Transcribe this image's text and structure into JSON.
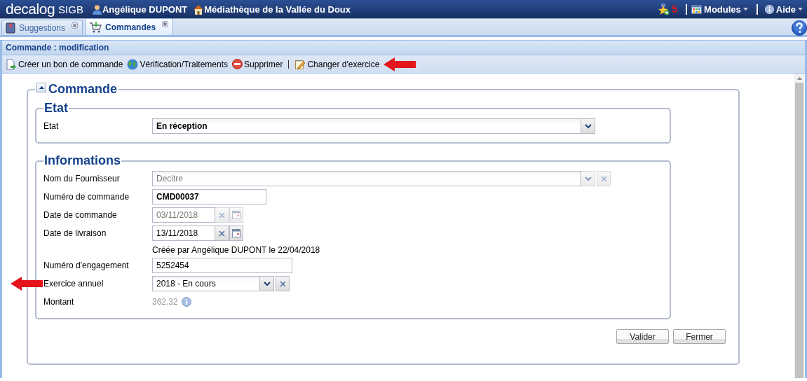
{
  "header": {
    "logo": "decalog",
    "logo_suffix": "SIGB",
    "user": "Angélique DUPONT",
    "library": "Médiathèque de la Vallée du Doux",
    "notifications": "5",
    "modules": "Modules",
    "help": "Aide"
  },
  "tabs": [
    {
      "label": "Suggestions",
      "selected": false,
      "kind": "book"
    },
    {
      "label": "Commandes",
      "selected": true,
      "kind": "cart"
    }
  ],
  "panel": {
    "title": "Commande : modification"
  },
  "toolbar": [
    {
      "kind": "new-doc",
      "label": "Créer un bon de commande",
      "pointed": false
    },
    {
      "kind": "globe",
      "label": "Vérification/Traitements",
      "pointed": false
    },
    {
      "kind": "delete",
      "label": "Supprimer",
      "pointed": false
    },
    {
      "kind": "separator"
    },
    {
      "kind": "edit",
      "label": "Changer d'exercice",
      "pointed": true
    }
  ],
  "form": {
    "legend": "Commande",
    "expanded": true,
    "sections": [
      {
        "legend": "Etat",
        "fields": [
          {
            "kind": "combo",
            "label": "Etat",
            "value": "En réception",
            "bold": true,
            "disabled": false,
            "clearable": false,
            "wide": true,
            "pointed": false
          }
        ]
      },
      {
        "legend": "Informations",
        "fields": [
          {
            "kind": "combo",
            "label": "Nom du Fournisseur",
            "value": "Decitre",
            "bold": false,
            "disabled": true,
            "clearable": true,
            "wide": true,
            "pointed": false
          },
          {
            "kind": "text",
            "label": "Numéro de commande",
            "value": "CMD00037",
            "bold": true,
            "pointed": false
          },
          {
            "kind": "date",
            "label": "Date de commande",
            "value": "03/11/2018",
            "disabled": true,
            "pointed": false
          },
          {
            "kind": "date",
            "label": "Date de livraison",
            "value": "13/11/2018",
            "disabled": false,
            "pointed": false
          },
          {
            "kind": "note",
            "value": "Créée par Angélique DUPONT le 22/04/2018"
          },
          {
            "kind": "text",
            "label": "Numéro d'engagement",
            "value": "5252454",
            "bold": false,
            "pointed": false
          },
          {
            "kind": "combo",
            "label": "Exercice annuel",
            "value": "2018 - En cours",
            "bold": false,
            "disabled": false,
            "clearable": true,
            "wide": false,
            "pointed": true
          },
          {
            "kind": "amount",
            "label": "Montant",
            "value": "362.32",
            "pointed": false
          }
        ]
      }
    ]
  },
  "buttons": [
    "Valider",
    "Fermer"
  ]
}
